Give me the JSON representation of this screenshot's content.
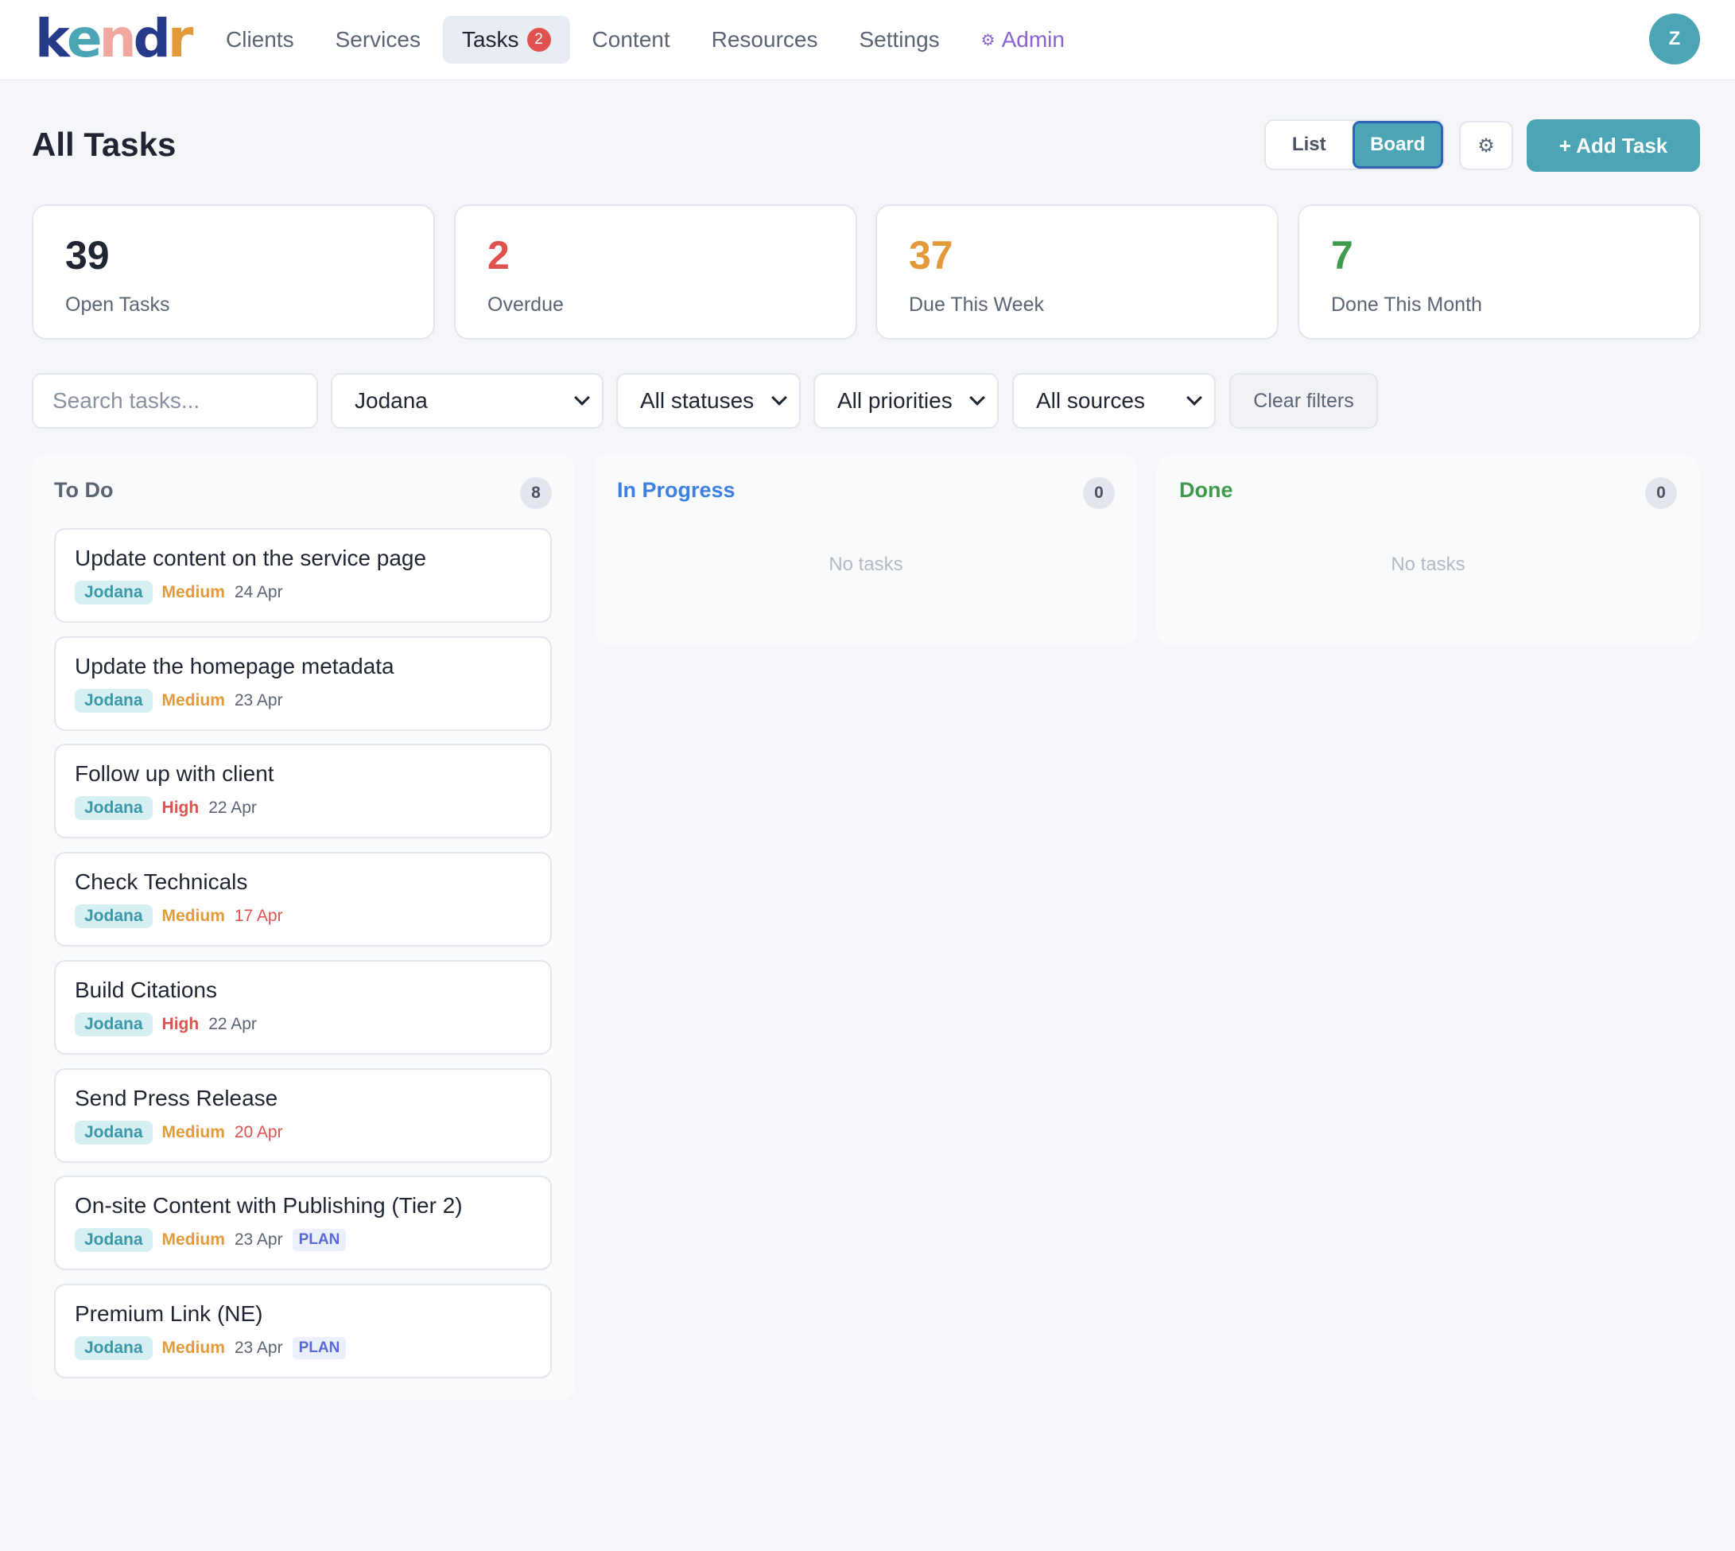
{
  "nav": {
    "logo": [
      "k",
      "e",
      "n",
      "d",
      "r"
    ],
    "items": [
      {
        "label": "Clients"
      },
      {
        "label": "Services"
      },
      {
        "label": "Tasks",
        "badge": "2"
      },
      {
        "label": "Content"
      },
      {
        "label": "Resources"
      },
      {
        "label": "Settings"
      },
      {
        "label": "Admin"
      }
    ],
    "avatar": "Z"
  },
  "header": {
    "title": "All Tasks",
    "view_list": "List",
    "view_board": "Board",
    "settings_icon": "⚙",
    "add_task": "+ Add Task"
  },
  "stats": [
    {
      "value": "39",
      "label": "Open Tasks",
      "color": "#1f2532"
    },
    {
      "value": "2",
      "label": "Overdue",
      "color": "#e0524f"
    },
    {
      "value": "37",
      "label": "Due This Week",
      "color": "#e39a39"
    },
    {
      "value": "7",
      "label": "Done This Month",
      "color": "#3f9a4c"
    }
  ],
  "filters": {
    "search_placeholder": "Search tasks...",
    "assignee": "Jodana",
    "status": "All statuses",
    "priority": "All priorities",
    "source": "All sources",
    "clear": "Clear filters"
  },
  "columns": [
    {
      "title": "To Do",
      "count": "8",
      "color": "#5b6475"
    },
    {
      "title": "In Progress",
      "count": "0",
      "color": "#3f7fe0",
      "empty": "No tasks"
    },
    {
      "title": "Done",
      "count": "0",
      "color": "#3f9a4c",
      "empty": "No tasks"
    }
  ],
  "tasks": [
    {
      "title": "Update content on the service page",
      "assignee": "Jodana",
      "priority": "Medium",
      "date": "24 Apr"
    },
    {
      "title": "Update the homepage metadata",
      "assignee": "Jodana",
      "priority": "Medium",
      "date": "23 Apr"
    },
    {
      "title": "Follow up with client",
      "assignee": "Jodana",
      "priority": "High",
      "date": "22 Apr"
    },
    {
      "title": "Check Technicals",
      "assignee": "Jodana",
      "priority": "Medium",
      "date": "17 Apr"
    },
    {
      "title": "Build Citations",
      "assignee": "Jodana",
      "priority": "High",
      "date": "22 Apr"
    },
    {
      "title": "Send Press Release",
      "assignee": "Jodana",
      "priority": "Medium",
      "date": "20 Apr"
    },
    {
      "title": "On-site Content with Publishing (Tier 2)",
      "assignee": "Jodana",
      "priority": "Medium",
      "date": "23 Apr",
      "tag": "PLAN"
    },
    {
      "title": "Premium Link (NE)",
      "assignee": "Jodana",
      "priority": "Medium",
      "date": "23 Apr",
      "tag": "PLAN"
    }
  ],
  "colors": {
    "accent": "#4ca5b4",
    "overdue": "#e0524f",
    "medium": "#e39a39",
    "admin": "#8a63d2"
  }
}
